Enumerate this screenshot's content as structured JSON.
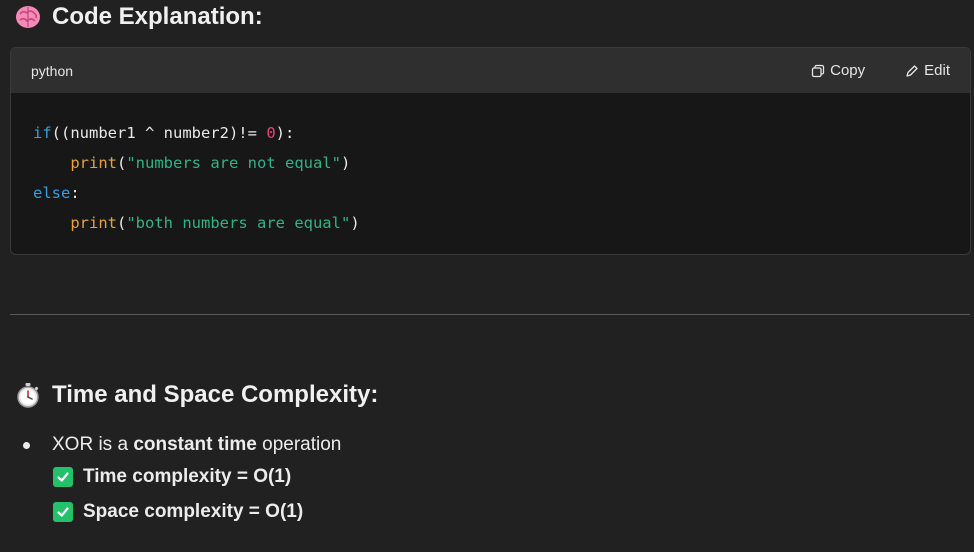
{
  "section1": {
    "title": "Code Explanation:",
    "icon": "brain-icon"
  },
  "code_block": {
    "language": "python",
    "copy_label": "Copy",
    "edit_label": "Edit",
    "lines": [
      "if((number1 ^ number2)!= 0):",
      "    print(\"numbers are not equal\")",
      "else:",
      "    print(\"both numbers are equal\")"
    ]
  },
  "section2": {
    "title": "Time and Space Complexity:",
    "icon": "stopwatch-icon"
  },
  "bullets": {
    "item1_prefix": "XOR is a ",
    "item1_bold": "constant time",
    "item1_suffix": " operation",
    "check1": "Time complexity = O(1)",
    "check2": "Space complexity = O(1)"
  },
  "colors": {
    "background": "#212121",
    "code_bg": "#171717",
    "keyword": "#2ea0e6",
    "function": "#e9a23b",
    "string": "#2fb38a",
    "number": "#e5437e",
    "check": "#24c16b"
  }
}
